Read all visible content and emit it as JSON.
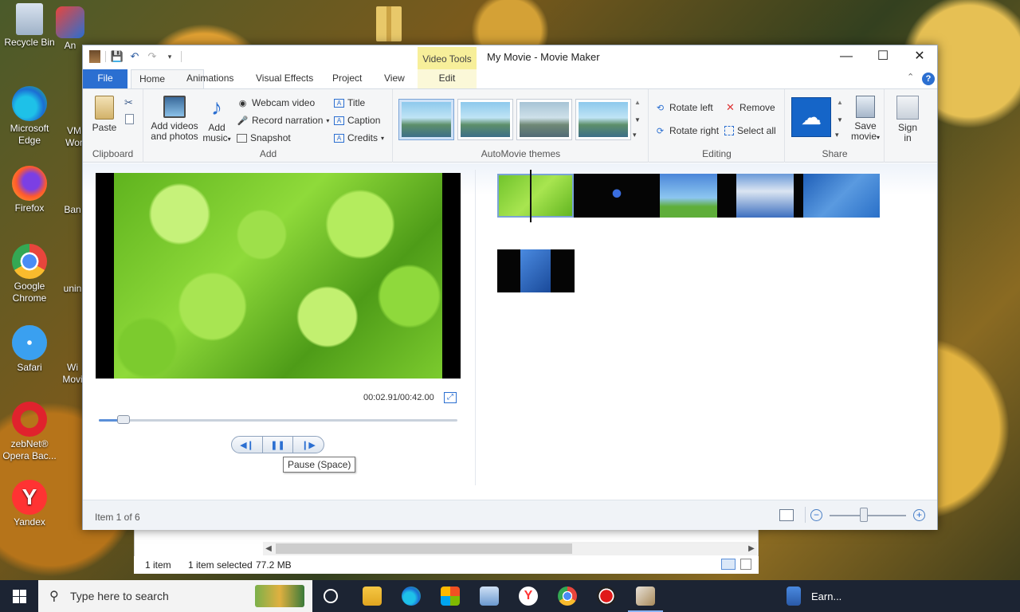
{
  "desktop": {
    "icons": [
      {
        "label": "Recycle Bin"
      },
      {
        "label": "Microsoft Edge"
      },
      {
        "label": "Firefox"
      },
      {
        "label": "Google Chrome"
      },
      {
        "label": "Safari"
      },
      {
        "label": "zebNet® Opera Bac..."
      },
      {
        "label": "Yandex"
      }
    ],
    "partial_labels": [
      "An",
      "VM",
      "Wor",
      "Ban",
      "unin",
      "Wi",
      "Movi"
    ]
  },
  "window": {
    "title": "My Movie - Movie Maker",
    "contextual_tab_header": "Video Tools",
    "controls": {
      "minimize": "—",
      "maximize": "☐",
      "close": "✕"
    }
  },
  "tabs": {
    "file": "File",
    "home": "Home",
    "animations": "Animations",
    "visual_effects": "Visual Effects",
    "project": "Project",
    "view": "View",
    "edit": "Edit"
  },
  "ribbon": {
    "clipboard": {
      "label": "Clipboard",
      "paste": "Paste"
    },
    "add": {
      "label": "Add",
      "add_videos": "Add videos",
      "add_videos_2": "and photos",
      "add_music": "Add",
      "add_music_2": "music",
      "webcam": "Webcam video",
      "narration": "Record narration",
      "snapshot": "Snapshot",
      "title": "Title",
      "caption": "Caption",
      "credits": "Credits"
    },
    "themes": {
      "label": "AutoMovie themes"
    },
    "editing": {
      "label": "Editing",
      "rotate_left": "Rotate left",
      "rotate_right": "Rotate right",
      "remove": "Remove",
      "select_all": "Select all"
    },
    "share": {
      "label": "Share",
      "save_movie": "Save",
      "save_movie_2": "movie",
      "sign_in": "Sign",
      "sign_in_2": "in"
    }
  },
  "player": {
    "timecode": "00:02.91/00:42.00",
    "position_fraction": 0.069,
    "tooltip": "Pause (Space)"
  },
  "status": {
    "item_text": "Item 1 of 6",
    "zoom_level_fraction": 0.45
  },
  "explorer": {
    "count": "1 item",
    "selected": "1 item selected",
    "size": "77.2 MB"
  },
  "taskbar": {
    "search_placeholder": "Type here to search",
    "open_app_label": "Earn..."
  },
  "colors": {
    "accent": "#2b6fd1",
    "contextual_tab": "#f7ef9a",
    "taskbar": "#1c2433"
  }
}
